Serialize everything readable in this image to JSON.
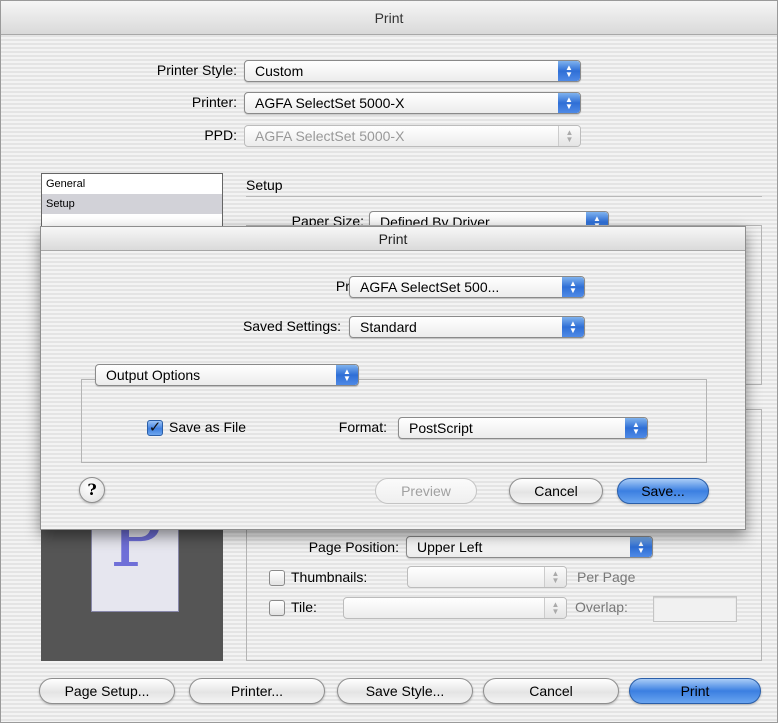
{
  "outer": {
    "title": "Print",
    "printer_style": {
      "label": "Printer Style:",
      "value": "Custom"
    },
    "printer": {
      "label": "Printer:",
      "value": "AGFA SelectSet 5000-X"
    },
    "ppd": {
      "label": "PPD:",
      "value": "AGFA SelectSet 5000-X"
    },
    "sidebar": {
      "items": [
        {
          "label": "General",
          "selected": false
        },
        {
          "label": "Setup",
          "selected": true
        }
      ]
    },
    "setup_heading": "Setup",
    "paper_size": {
      "label": "Paper Size:",
      "value": "Defined By Driver"
    },
    "preview_glyph": "P",
    "page_position": {
      "label": "Page Position:",
      "value": "Upper Left"
    },
    "thumbnails": {
      "label": "Thumbnails:",
      "value": "",
      "suffix": "Per Page"
    },
    "tile": {
      "label": "Tile:",
      "value": "",
      "overlap_label": "Overlap:"
    },
    "buttons": {
      "page_setup": "Page Setup...",
      "printer": "Printer...",
      "save_style": "Save Style...",
      "cancel": "Cancel",
      "print": "Print"
    }
  },
  "sheet": {
    "title": "Print",
    "printer": {
      "label": "Printer:",
      "value": "AGFA SelectSet 500..."
    },
    "saved_settings": {
      "label": "Saved Settings:",
      "value": "Standard"
    },
    "panel": {
      "value": "Output Options"
    },
    "save_as_file": {
      "label": "Save as File",
      "checked": true
    },
    "format": {
      "label": "Format:",
      "value": "PostScript"
    },
    "help": "?",
    "buttons": {
      "preview": "Preview",
      "cancel": "Cancel",
      "save": "Save..."
    }
  },
  "colors": {
    "accent_blue": "#3b7fe1",
    "preview_glyph": "#6f6fd8",
    "preview_bg": "#555555"
  },
  "icons": {
    "popup_arrows": "updown-arrows-icon",
    "checkmark": "checkmark-icon",
    "help": "help-icon"
  }
}
